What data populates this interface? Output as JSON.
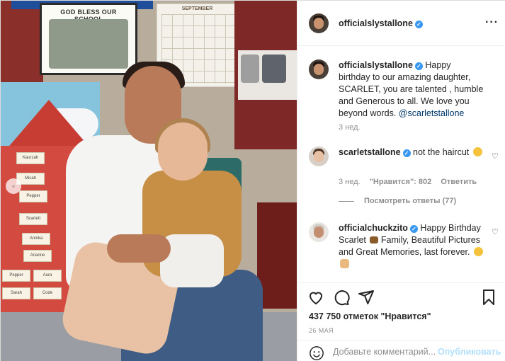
{
  "post": {
    "author": "officialslystallone",
    "photo": {
      "poster_text": "GOD BLESS OUR SCHOOL",
      "calendar_month": "SEPTEMBER",
      "name_tags": [
        "Kaurzah",
        "Micah",
        "Pepper",
        "Scarlett",
        "Annika",
        "Arianne",
        "Pepper",
        "Aura",
        "Code",
        "Sarah"
      ]
    }
  },
  "header": {
    "username": "officialslystallone",
    "more_icon": "more-horizontal-icon"
  },
  "comments": [
    {
      "username": "officialslystallone",
      "text": "Happy birthday to our amazing daughter, SCARLET, you are talented , humble and Generous to all. We love you beyond words.",
      "mention": "@scarletstallone",
      "time": "3 нед."
    },
    {
      "username": "scarletstallone",
      "text": "not the haircut",
      "time": "3 нед.",
      "likes": "\"Нравится\": 802",
      "reply": "Ответить"
    },
    {
      "username": "officialchuckzito",
      "text": "Happy Birthday Scarlet",
      "text2": "Family, Beautiful Pictures and Great Memories, last forever."
    }
  ],
  "view_replies": "Посмотреть ответы (77)",
  "actions": {
    "likes_text": "437 750 отметок \"Нравится\"",
    "date": "26 МАЯ",
    "comment_placeholder": "Добавьте комментарий...",
    "publish_label": "Опубликовать"
  }
}
